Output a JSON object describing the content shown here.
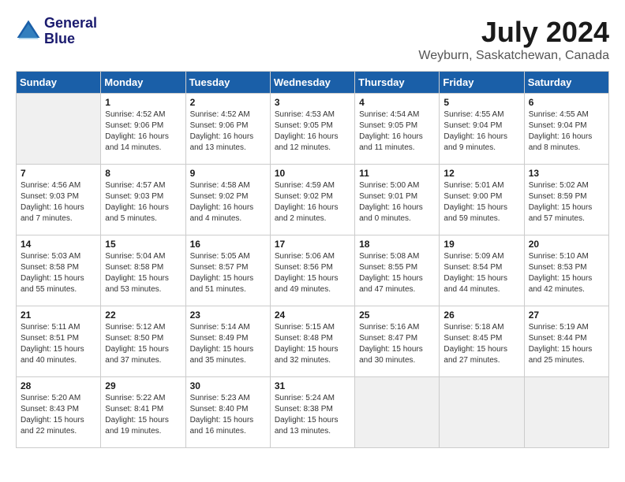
{
  "logo": {
    "line1": "General",
    "line2": "Blue"
  },
  "title": "July 2024",
  "subtitle": "Weyburn, Saskatchewan, Canada",
  "weekdays": [
    "Sunday",
    "Monday",
    "Tuesday",
    "Wednesday",
    "Thursday",
    "Friday",
    "Saturday"
  ],
  "weeks": [
    [
      {
        "day": "",
        "info": ""
      },
      {
        "day": "1",
        "info": "Sunrise: 4:52 AM\nSunset: 9:06 PM\nDaylight: 16 hours\nand 14 minutes."
      },
      {
        "day": "2",
        "info": "Sunrise: 4:52 AM\nSunset: 9:06 PM\nDaylight: 16 hours\nand 13 minutes."
      },
      {
        "day": "3",
        "info": "Sunrise: 4:53 AM\nSunset: 9:05 PM\nDaylight: 16 hours\nand 12 minutes."
      },
      {
        "day": "4",
        "info": "Sunrise: 4:54 AM\nSunset: 9:05 PM\nDaylight: 16 hours\nand 11 minutes."
      },
      {
        "day": "5",
        "info": "Sunrise: 4:55 AM\nSunset: 9:04 PM\nDaylight: 16 hours\nand 9 minutes."
      },
      {
        "day": "6",
        "info": "Sunrise: 4:55 AM\nSunset: 9:04 PM\nDaylight: 16 hours\nand 8 minutes."
      }
    ],
    [
      {
        "day": "7",
        "info": "Sunrise: 4:56 AM\nSunset: 9:03 PM\nDaylight: 16 hours\nand 7 minutes."
      },
      {
        "day": "8",
        "info": "Sunrise: 4:57 AM\nSunset: 9:03 PM\nDaylight: 16 hours\nand 5 minutes."
      },
      {
        "day": "9",
        "info": "Sunrise: 4:58 AM\nSunset: 9:02 PM\nDaylight: 16 hours\nand 4 minutes."
      },
      {
        "day": "10",
        "info": "Sunrise: 4:59 AM\nSunset: 9:02 PM\nDaylight: 16 hours\nand 2 minutes."
      },
      {
        "day": "11",
        "info": "Sunrise: 5:00 AM\nSunset: 9:01 PM\nDaylight: 16 hours\nand 0 minutes."
      },
      {
        "day": "12",
        "info": "Sunrise: 5:01 AM\nSunset: 9:00 PM\nDaylight: 15 hours\nand 59 minutes."
      },
      {
        "day": "13",
        "info": "Sunrise: 5:02 AM\nSunset: 8:59 PM\nDaylight: 15 hours\nand 57 minutes."
      }
    ],
    [
      {
        "day": "14",
        "info": "Sunrise: 5:03 AM\nSunset: 8:58 PM\nDaylight: 15 hours\nand 55 minutes."
      },
      {
        "day": "15",
        "info": "Sunrise: 5:04 AM\nSunset: 8:58 PM\nDaylight: 15 hours\nand 53 minutes."
      },
      {
        "day": "16",
        "info": "Sunrise: 5:05 AM\nSunset: 8:57 PM\nDaylight: 15 hours\nand 51 minutes."
      },
      {
        "day": "17",
        "info": "Sunrise: 5:06 AM\nSunset: 8:56 PM\nDaylight: 15 hours\nand 49 minutes."
      },
      {
        "day": "18",
        "info": "Sunrise: 5:08 AM\nSunset: 8:55 PM\nDaylight: 15 hours\nand 47 minutes."
      },
      {
        "day": "19",
        "info": "Sunrise: 5:09 AM\nSunset: 8:54 PM\nDaylight: 15 hours\nand 44 minutes."
      },
      {
        "day": "20",
        "info": "Sunrise: 5:10 AM\nSunset: 8:53 PM\nDaylight: 15 hours\nand 42 minutes."
      }
    ],
    [
      {
        "day": "21",
        "info": "Sunrise: 5:11 AM\nSunset: 8:51 PM\nDaylight: 15 hours\nand 40 minutes."
      },
      {
        "day": "22",
        "info": "Sunrise: 5:12 AM\nSunset: 8:50 PM\nDaylight: 15 hours\nand 37 minutes."
      },
      {
        "day": "23",
        "info": "Sunrise: 5:14 AM\nSunset: 8:49 PM\nDaylight: 15 hours\nand 35 minutes."
      },
      {
        "day": "24",
        "info": "Sunrise: 5:15 AM\nSunset: 8:48 PM\nDaylight: 15 hours\nand 32 minutes."
      },
      {
        "day": "25",
        "info": "Sunrise: 5:16 AM\nSunset: 8:47 PM\nDaylight: 15 hours\nand 30 minutes."
      },
      {
        "day": "26",
        "info": "Sunrise: 5:18 AM\nSunset: 8:45 PM\nDaylight: 15 hours\nand 27 minutes."
      },
      {
        "day": "27",
        "info": "Sunrise: 5:19 AM\nSunset: 8:44 PM\nDaylight: 15 hours\nand 25 minutes."
      }
    ],
    [
      {
        "day": "28",
        "info": "Sunrise: 5:20 AM\nSunset: 8:43 PM\nDaylight: 15 hours\nand 22 minutes."
      },
      {
        "day": "29",
        "info": "Sunrise: 5:22 AM\nSunset: 8:41 PM\nDaylight: 15 hours\nand 19 minutes."
      },
      {
        "day": "30",
        "info": "Sunrise: 5:23 AM\nSunset: 8:40 PM\nDaylight: 15 hours\nand 16 minutes."
      },
      {
        "day": "31",
        "info": "Sunrise: 5:24 AM\nSunset: 8:38 PM\nDaylight: 15 hours\nand 13 minutes."
      },
      {
        "day": "",
        "info": ""
      },
      {
        "day": "",
        "info": ""
      },
      {
        "day": "",
        "info": ""
      }
    ]
  ]
}
